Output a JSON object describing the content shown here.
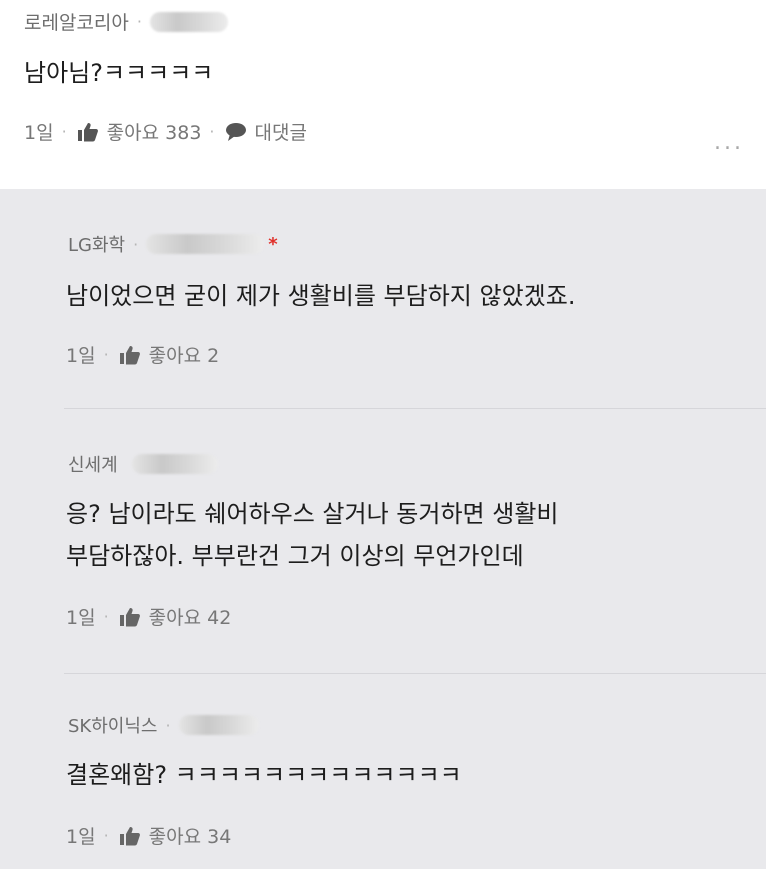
{
  "post": {
    "author": "로레알코리아",
    "text": "남아님?ㅋㅋㅋㅋㅋ",
    "time": "1일",
    "like_label": "좋아요 383",
    "reply_label": "대댓글",
    "more": "..."
  },
  "replies": [
    {
      "author": "LG화학",
      "marker": "*",
      "lines": [
        "남이었으면 굳이 제가 생활비를 부담하지 않았겠죠."
      ],
      "time": "1일",
      "like_label": "좋아요 2"
    },
    {
      "author": "신세계",
      "lines": [
        "응? 남이라도 쉐어하우스 살거나 동거하면 생활비",
        "부담하잖아. 부부란건 그거 이상의 무언가인데"
      ],
      "time": "1일",
      "like_label": "좋아요 42"
    },
    {
      "author": "SK하이닉스",
      "lines": [
        "결혼왜함? ㅋㅋㅋㅋㅋㅋㅋㅋㅋㅋㅋㅋㅋ"
      ],
      "time": "1일",
      "like_label": "좋아요 34"
    }
  ],
  "colors": {
    "reply_background": "#e9e9ec",
    "marker": "#e0302a"
  }
}
